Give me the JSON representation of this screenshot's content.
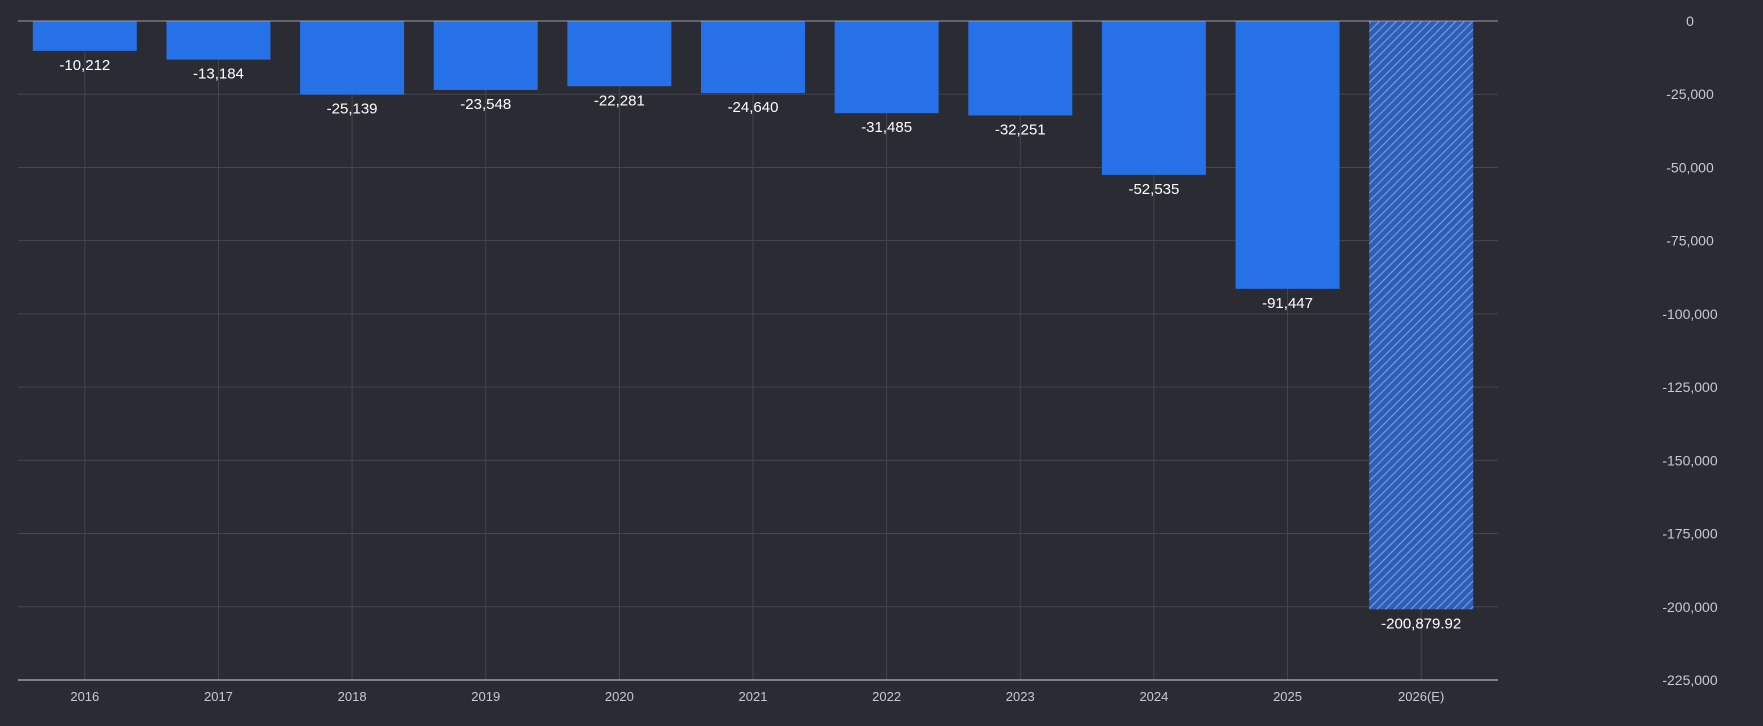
{
  "chart_data": {
    "type": "bar",
    "categories": [
      "2016",
      "2017",
      "2018",
      "2019",
      "2020",
      "2021",
      "2022",
      "2023",
      "2024",
      "2025",
      "2026(E)"
    ],
    "values": [
      -10212,
      -13184,
      -25139,
      -23548,
      -22281,
      -24640,
      -31485,
      -32251,
      -52535,
      -91447,
      -200879.92
    ],
    "value_labels": [
      "-10,212",
      "-13,184",
      "-25,139",
      "-23,548",
      "-22,281",
      "-24,640",
      "-31,485",
      "-32,251",
      "-52,535",
      "-91,447",
      "-200,879.92"
    ],
    "estimated": [
      false,
      false,
      false,
      false,
      false,
      false,
      false,
      false,
      false,
      false,
      true
    ],
    "y_ticks": [
      0,
      -25000,
      -50000,
      -75000,
      -100000,
      -125000,
      -150000,
      -175000,
      -200000,
      -225000
    ],
    "y_tick_labels": [
      "0",
      "-25,000",
      "-50,000",
      "-75,000",
      "-100,000",
      "-125,000",
      "-150,000",
      "-175,000",
      "-200,000",
      "-225,000"
    ],
    "ylim": [
      -225000,
      0
    ],
    "grid": true,
    "title": "",
    "xlabel": "",
    "ylabel": ""
  },
  "colors": {
    "background": "#2a2b33",
    "bar": "#2671e8",
    "bar_estimated": "#2f5fb5",
    "hatch": "#7aa4ec",
    "grid": "#45464f",
    "axis": "#9a9ba3",
    "tick_label": "#c9cad0",
    "value_label": "#ffffff"
  }
}
